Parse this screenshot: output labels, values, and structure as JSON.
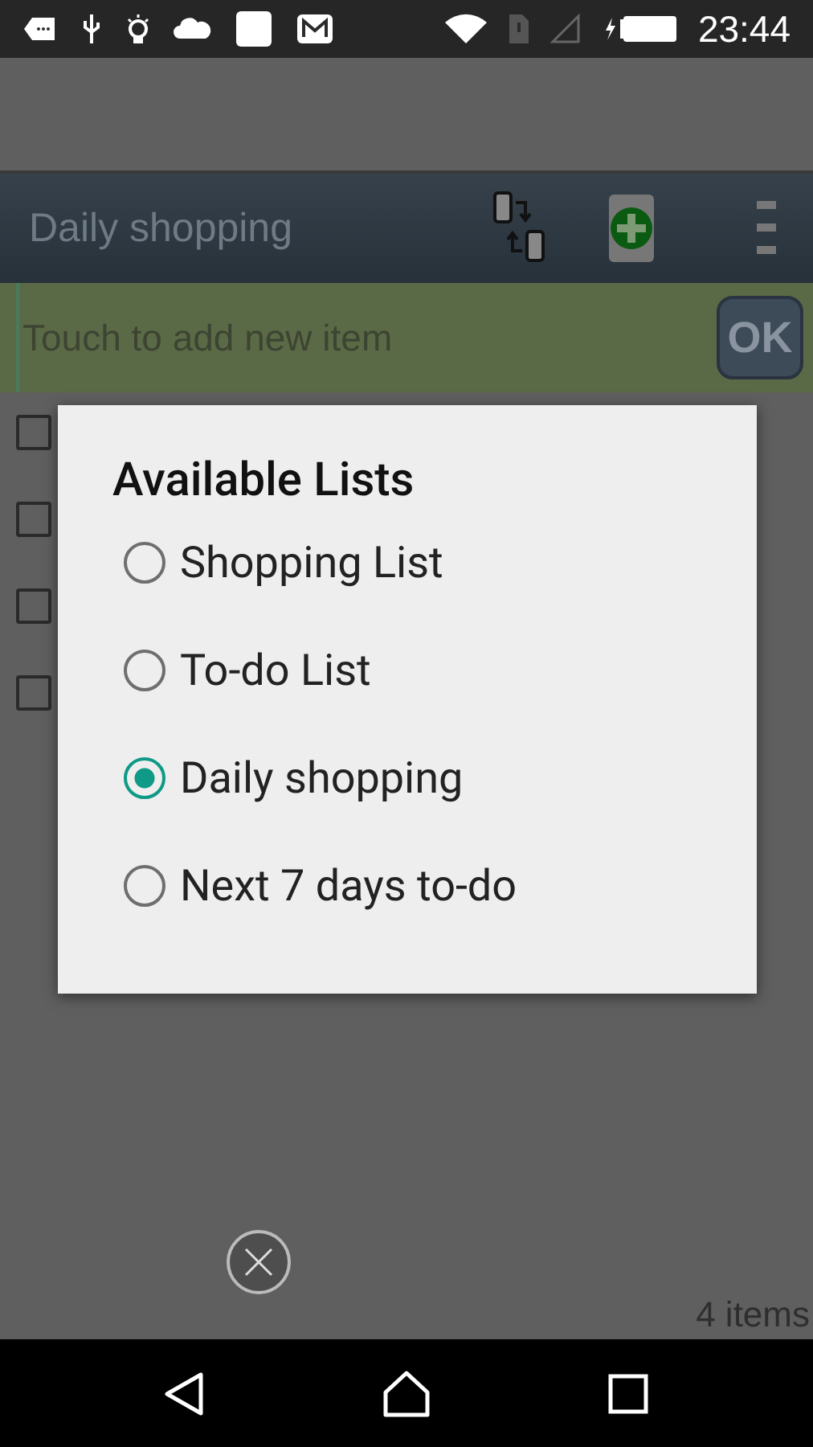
{
  "status_bar": {
    "time": "23:44"
  },
  "toolbar": {
    "title": "Daily shopping"
  },
  "add_item": {
    "placeholder": "Touch to add new item",
    "button": "OK"
  },
  "items": [
    {
      "checked": false
    },
    {
      "checked": false
    },
    {
      "checked": false
    },
    {
      "checked": false
    }
  ],
  "footer": {
    "count": "4 items"
  },
  "dialog": {
    "title": "Available Lists",
    "options": [
      {
        "label": "Shopping List",
        "selected": false
      },
      {
        "label": "To-do List",
        "selected": false
      },
      {
        "label": "Daily shopping",
        "selected": true
      },
      {
        "label": "Next 7 days to-do",
        "selected": false
      }
    ]
  }
}
